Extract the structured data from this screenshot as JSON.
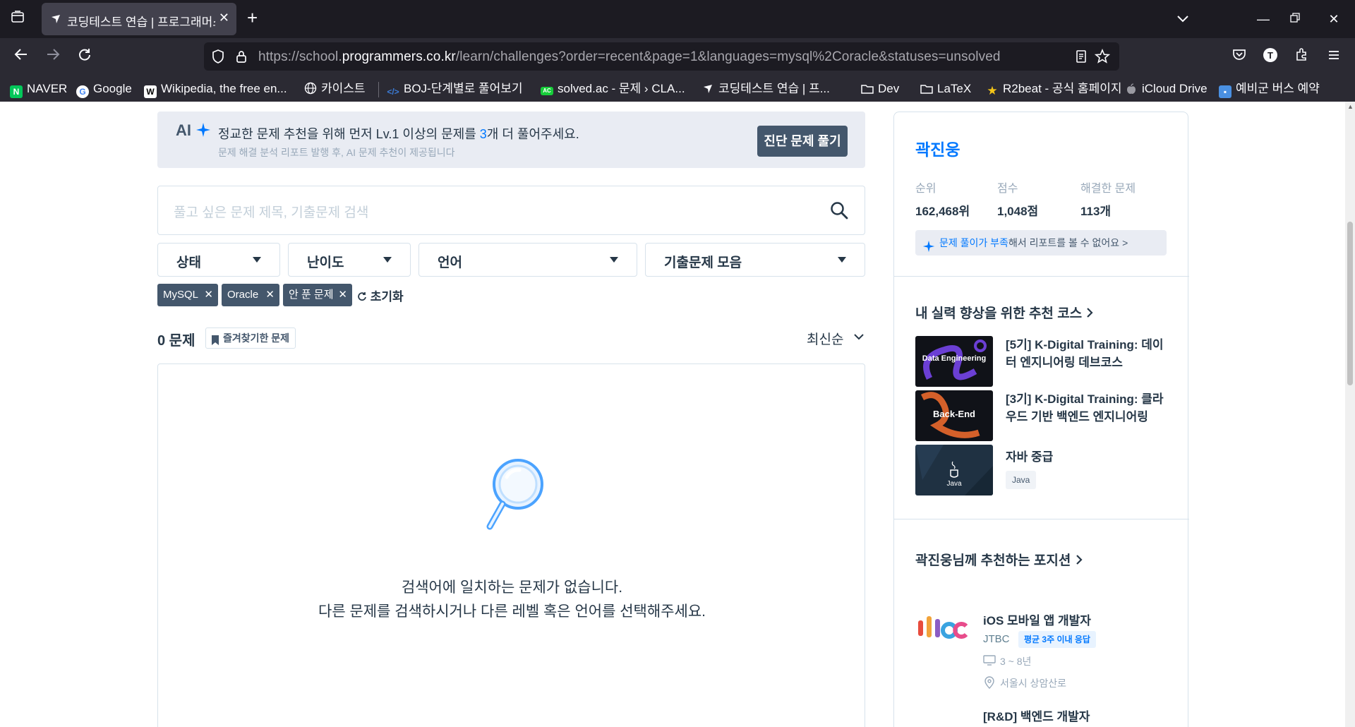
{
  "browser": {
    "tab_title": "코딩테스트 연습 | 프로그래머스 스쿨",
    "url_prefix": "https://school.",
    "url_host": "programmers.co.kr",
    "url_path": "/learn/challenges?order=recent&page=1&languages=mysql%2Coracle&statuses=unsolved",
    "bookmarks": [
      {
        "label": "NAVER",
        "icon": "naver-icon",
        "color": "#03c75a"
      },
      {
        "label": "Google",
        "icon": "google-icon",
        "color": "#ffffff"
      },
      {
        "label": "Wikipedia, the free en...",
        "icon": "wikipedia-icon",
        "color": "#ffffff"
      },
      {
        "label": "카이스트",
        "icon": "globe-icon",
        "color": "#fbfbfe"
      },
      {
        "label": "BOJ-단계별로 풀어보기",
        "icon": "boj-icon",
        "color": "#3b7bd6"
      },
      {
        "label": "solved.ac - 문제 › CLA...",
        "icon": "solvedac-icon",
        "color": "#17ce3a"
      },
      {
        "label": "코딩테스트 연습 | 프...",
        "icon": "programmers-icon",
        "color": "#fbfbfe"
      },
      {
        "label": "Dev",
        "icon": "folder-icon",
        "color": "#fbfbfe"
      },
      {
        "label": "LaTeX",
        "icon": "folder-icon",
        "color": "#fbfbfe"
      },
      {
        "label": "R2beat - 공식 홈페이지",
        "icon": "r2beat-icon",
        "color": "#f5c518"
      },
      {
        "label": "iCloud Drive",
        "icon": "apple-icon",
        "color": "#fbfbfe"
      },
      {
        "label": "예비군 버스 예약",
        "icon": "bus-icon",
        "color": "#4a90e2"
      }
    ]
  },
  "ai_banner": {
    "logo": "AI",
    "message_pre": "정교한 문제 추천을 위해 먼저 Lv.1 이상의 문제를 ",
    "message_num": "3",
    "message_post": "개 더 풀어주세요.",
    "sub": "문제 해결 분석 리포트 발행 후, AI 문제 추천이 제공됩니다",
    "button": "진단 문제 풀기"
  },
  "search": {
    "placeholder": "풀고 싶은 문제 제목, 기출문제 검색"
  },
  "filters": {
    "status": "상태",
    "difficulty": "난이도",
    "language": "언어",
    "past_exams": "기출문제 모음"
  },
  "chips": [
    "MySQL",
    "Oracle",
    "안 푼 문제"
  ],
  "reset": "초기화",
  "list": {
    "count": "0 문제",
    "favorites": "즐겨찾기한 문제",
    "sort": "최신순",
    "empty_line1": "검색어에 일치하는 문제가 없습니다.",
    "empty_line2": "다른 문제를 검색하시거나 다른 레벨 혹은 언어를 선택해주세요."
  },
  "profile": {
    "name": "곽진웅",
    "rank_label": "순위",
    "rank": "162,468위",
    "score_label": "점수",
    "score": "1,048점",
    "solved_label": "해결한 문제",
    "solved": "113개",
    "report_bold": "문제 풀이가 부족",
    "report_rest": "해서 리포트를 볼 수 없어요",
    "report_chev": ">"
  },
  "courses": {
    "title": "내 실력 향상을 위한 추천 코스",
    "items": [
      {
        "title": "[5기] K-Digital Training: 데이터 엔지니어링 데브코스",
        "thumb_text": "Data Engineering"
      },
      {
        "title": "[3기] K-Digital Training: 클라우드 기반 백엔드 엔지니어링",
        "thumb_text": "Back-End"
      },
      {
        "title": "자바 중급",
        "thumb_text": "Java",
        "tag": "Java"
      }
    ]
  },
  "positions": {
    "title": "곽진웅님께 추천하는 포지션",
    "job_title": "iOS 모바일 앱 개발자",
    "company": "JTBC",
    "badge": "평균 3주 이내 응답",
    "experience": "3 ~ 8년",
    "location": "서울시 상암산로",
    "next_job": "[R&D] 백엔드 개발자"
  },
  "colors": {
    "accent": "#0078ff",
    "dark": "#263747",
    "button": "#44576c"
  }
}
